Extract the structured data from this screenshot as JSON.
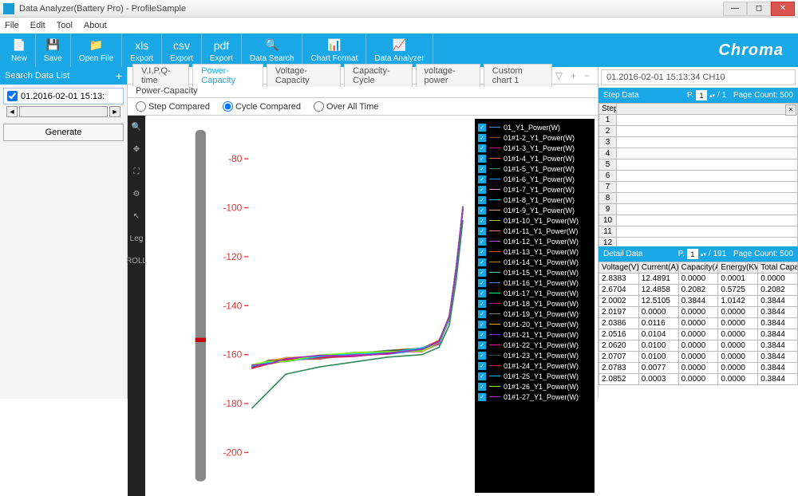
{
  "window": {
    "title": "Data Analyzer(Battery Pro) - ProfileSample"
  },
  "menu": [
    "File",
    "Edit",
    "Tool",
    "About"
  ],
  "ribbon": {
    "items": [
      {
        "label": "New",
        "icon": "📄"
      },
      {
        "label": "Save",
        "icon": "💾"
      },
      {
        "label": "Open File",
        "icon": "📁"
      },
      {
        "label": "Export",
        "icon": "xls"
      },
      {
        "label": "Export",
        "icon": "csv"
      },
      {
        "label": "Export",
        "icon": "pdf"
      },
      {
        "label": "Data Search",
        "icon": "🔍"
      },
      {
        "label": "Chart Format",
        "icon": "📊"
      },
      {
        "label": "Data Analyzer",
        "icon": "📈"
      }
    ],
    "brand": "Chroma"
  },
  "sidebar": {
    "header": "Search Data List",
    "item": "01.2016-02-01 15:13:",
    "generate": "Generate"
  },
  "tabs": {
    "items": [
      "V,I,P,Q-time",
      "Power-Capacity",
      "Voltage-Capacity",
      "Capacity-Cycle",
      "voltage-power",
      "Custom chart 1"
    ],
    "active_index": 1,
    "chart_name": "Power-Capacity"
  },
  "compare": {
    "options": [
      "Step Compared",
      "Cycle Compared",
      "Over All Time"
    ],
    "selected_index": 1
  },
  "chart_toolbar": [
    "🔍",
    "✥",
    "⛶",
    "⚙",
    "↖",
    "Leg",
    "ROLL"
  ],
  "legend": {
    "items": [
      {
        "label": "01_Y1_Power(W)",
        "color": "#4a90d9"
      },
      {
        "label": "01#1-2_Y1_Power(W)",
        "color": "#8b4513"
      },
      {
        "label": "01#1-3_Y1_Power(W)",
        "color": "#c71585"
      },
      {
        "label": "01#1-4_Y1_Power(W)",
        "color": "#ff6347"
      },
      {
        "label": "01#1-5_Y1_Power(W)",
        "color": "#2e8b57"
      },
      {
        "label": "01#1-6_Y1_Power(W)",
        "color": "#1e90ff"
      },
      {
        "label": "01#1-7_Y1_Power(W)",
        "color": "#dda0dd"
      },
      {
        "label": "01#1-8_Y1_Power(W)",
        "color": "#00ced1"
      },
      {
        "label": "01#1-9_Y1_Power(W)",
        "color": "#e9967a"
      },
      {
        "label": "01#1-10_Y1_Power(W)",
        "color": "#9acd32"
      },
      {
        "label": "01#1-11_Y1_Power(W)",
        "color": "#fa8072"
      },
      {
        "label": "01#1-12_Y1_Power(W)",
        "color": "#ba55d3"
      },
      {
        "label": "01#1-13_Y1_Power(W)",
        "color": "#ff4500"
      },
      {
        "label": "01#1-14_Y1_Power(W)",
        "color": "#b8860b"
      },
      {
        "label": "01#1-15_Y1_Power(W)",
        "color": "#48d1cc"
      },
      {
        "label": "01#1-16_Y1_Power(W)",
        "color": "#4682b4"
      },
      {
        "label": "01#1-17_Y1_Power(W)",
        "color": "#00ff7f"
      },
      {
        "label": "01#1-18_Y1_Power(W)",
        "color": "#c71585"
      },
      {
        "label": "01#1-19_Y1_Power(W)",
        "color": "#708090"
      },
      {
        "label": "01#1-20_Y1_Power(W)",
        "color": "#ffa500"
      },
      {
        "label": "01#1-21_Y1_Power(W)",
        "color": "#8a2be2"
      },
      {
        "label": "01#1-22_Y1_Power(W)",
        "color": "#ff1493"
      },
      {
        "label": "01#1-23_Y1_Power(W)",
        "color": "#2f4f4f"
      },
      {
        "label": "01#1-24_Y1_Power(W)",
        "color": "#dc143c"
      },
      {
        "label": "01#1-25_Y1_Power(W)",
        "color": "#00bfff"
      },
      {
        "label": "01#1-26_Y1_Power(W)",
        "color": "#7fff00"
      },
      {
        "label": "01#1-27_Y1_Power(W)",
        "color": "#9932cc"
      }
    ]
  },
  "data_panel": {
    "file_label": "01.2016-02-01 15:13:34 CH10",
    "step": {
      "title": "Step Data",
      "page_label": "P.",
      "page_value": "1",
      "page_total": "/  1",
      "page_count": "Page Count:   500",
      "header": "Step",
      "rows": [
        "1",
        "2",
        "3",
        "4",
        "5",
        "6",
        "7",
        "8",
        "9",
        "10",
        "11",
        "12"
      ]
    },
    "detail": {
      "title": "Detail Data",
      "page_label": "P.",
      "page_value": "1",
      "page_total": "/  191",
      "page_count": "Page Count:   500",
      "columns": [
        "Voltage(V)",
        "Current(A)",
        "Capacity(Ah)",
        "Energy(KWh)",
        "Total Capa"
      ],
      "rows": [
        [
          "2.8383",
          "12.4891",
          "0.0000",
          "0.0001",
          "0.0000"
        ],
        [
          "2.6704",
          "12.4858",
          "0.2082",
          "0.5725",
          "0.2082"
        ],
        [
          "2.0002",
          "12.5105",
          "0.3844",
          "1.0142",
          "0.3844"
        ],
        [
          "2.0197",
          "0.0000",
          "0.0000",
          "0.0000",
          "0.3844"
        ],
        [
          "2.0386",
          "0.0116",
          "0.0000",
          "0.0000",
          "0.3844"
        ],
        [
          "2.0516",
          "0.0104",
          "0.0000",
          "0.0000",
          "0.3844"
        ],
        [
          "2.0620",
          "0.0100",
          "0.0000",
          "0.0000",
          "0.3844"
        ],
        [
          "2.0707",
          "0.0100",
          "0.0000",
          "0.0000",
          "0.3844"
        ],
        [
          "2.0783",
          "0.0077",
          "0.0000",
          "0.0000",
          "0.3844"
        ],
        [
          "2.0852",
          "0.0003",
          "0.0000",
          "0.0000",
          "0.3844"
        ]
      ]
    }
  },
  "chart_data": {
    "type": "line",
    "ylabel": "",
    "xlabel": "",
    "ylim": [
      -210,
      -70
    ],
    "yticks": [
      -80,
      -100,
      -120,
      -140,
      -160,
      -180,
      -200
    ],
    "x": [
      0,
      0.05,
      0.1,
      0.2,
      0.3,
      0.4,
      0.5,
      0.55,
      0.58,
      0.6,
      0.62
    ],
    "series_approx": {
      "main_cluster_y": [
        -165,
        -163,
        -162,
        -161,
        -160,
        -159,
        -158,
        -155,
        -145,
        -125,
        -100
      ],
      "outlier_low_y": [
        -182,
        -175,
        -168,
        -165,
        -163,
        -161,
        -160,
        -157,
        -148,
        -130,
        -105
      ]
    }
  }
}
